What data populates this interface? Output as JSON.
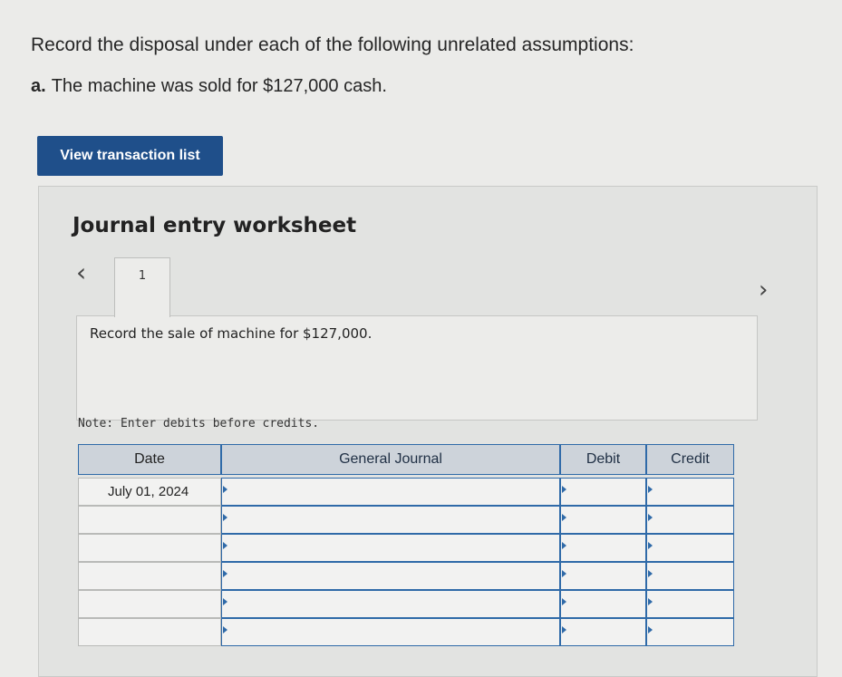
{
  "instruction": "Record the disposal under each of the following unrelated assumptions:",
  "assumption": {
    "letter": "a.",
    "text": "The machine was sold for $127,000 cash."
  },
  "view_button_label": "View transaction list",
  "worksheet": {
    "title": "Journal entry worksheet",
    "nav_prev_icon": "chevron-left-icon",
    "nav_next_icon": "chevron-right-icon",
    "tab_label": "1",
    "prompt": "Record the sale of machine for $127,000.",
    "note": "Note: Enter debits before credits."
  },
  "journal": {
    "headers": {
      "date": "Date",
      "general_journal": "General Journal",
      "debit": "Debit",
      "credit": "Credit"
    },
    "rows": [
      {
        "date": "July 01, 2024",
        "account": "",
        "debit": "",
        "credit": ""
      },
      {
        "date": "",
        "account": "",
        "debit": "",
        "credit": ""
      },
      {
        "date": "",
        "account": "",
        "debit": "",
        "credit": ""
      },
      {
        "date": "",
        "account": "",
        "debit": "",
        "credit": ""
      },
      {
        "date": "",
        "account": "",
        "debit": "",
        "credit": ""
      },
      {
        "date": "",
        "account": "",
        "debit": "",
        "credit": ""
      }
    ]
  },
  "colors": {
    "button_bg": "#1f4f8a",
    "grid_border": "#2f6aa8",
    "header_bg": "#cdd3da"
  }
}
